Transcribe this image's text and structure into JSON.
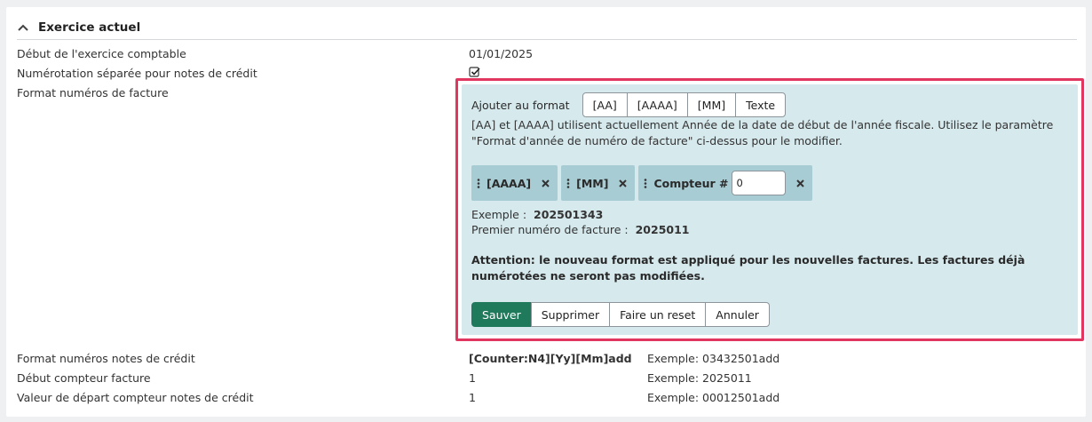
{
  "section": {
    "title": "Exercice actuel"
  },
  "rows": {
    "start_label": "Début de l'exercice comptable",
    "start_value": "01/01/2025",
    "separate_label": "Numérotation séparée pour notes de crédit",
    "format_label": "Format numéros de facture"
  },
  "editor": {
    "add_label": "Ajouter au format",
    "add_buttons": [
      "[AA]",
      "[AAAA]",
      "[MM]",
      "Texte"
    ],
    "info": "[AA] et [AAAA] utilisent actuellement Année de la date de début de l'année fiscale. Utilisez le paramètre \"Format d'année de numéro de facture\" ci-dessus pour le modifier.",
    "chips": [
      "[AAAA]",
      "[MM]",
      "Compteur #"
    ],
    "counter_value": "0",
    "example_label": "Exemple :",
    "example_value": "202501343",
    "first_label": "Premier numéro de facture :",
    "first_value": "2025011",
    "warning": "Attention: le nouveau format est appliqué pour les nouvelles factures. Les factures déjà numérotées ne seront pas modifiées.",
    "actions": [
      "Sauver",
      "Supprimer",
      "Faire un reset",
      "Annuler"
    ]
  },
  "bottom_rows": [
    {
      "label": "Format numéros notes de crédit",
      "value": "[Counter:N4][Yy][Mm]add",
      "example": "Exemple: 03432501add"
    },
    {
      "label": "Début compteur facture",
      "value": "1",
      "example": "Exemple: 2025011"
    },
    {
      "label": "Valeur de départ compteur notes de crédit",
      "value": "1",
      "example": "Exemple: 00012501add"
    }
  ],
  "colors": {
    "accent_primary": "#1f7a5c",
    "highlight_border": "#e0365f",
    "editor_bg": "#d6e9ed",
    "chip_bg": "#a7ccd4"
  }
}
